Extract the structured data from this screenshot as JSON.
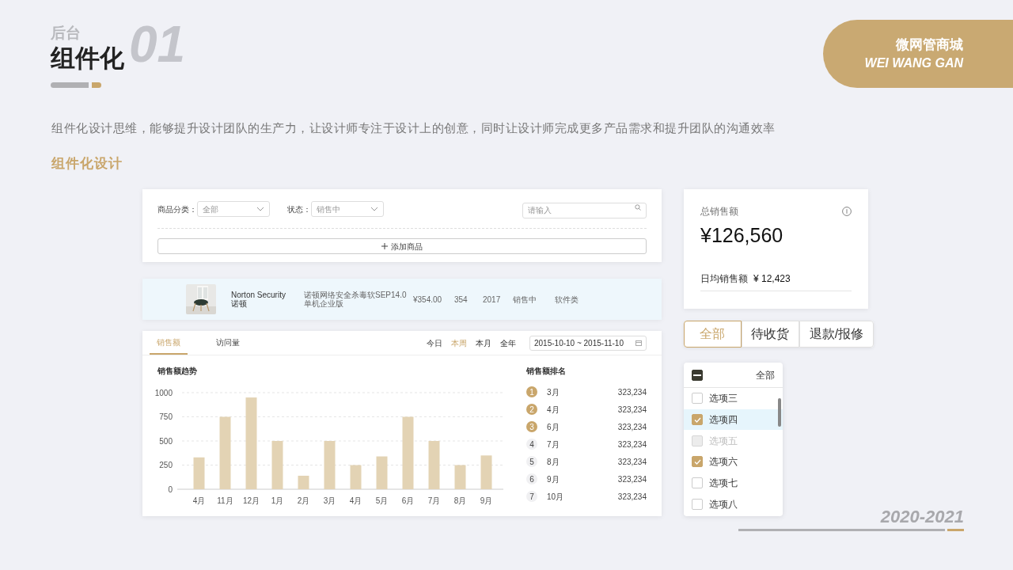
{
  "header": {
    "number": "01",
    "subtitle": "后台",
    "title": "组件化"
  },
  "brand": {
    "name": "微网管商城",
    "latin": "WEI WANG GAN"
  },
  "intro": "组件化设计思维，能够提升设计团队的生产力，让设计师专注于设计上的创意，同时让设计师完成更多产品需求和提升团队的沟通效率",
  "section_title": "组件化设计",
  "filter_card": {
    "fields": [
      {
        "label": "商品分类：",
        "placeholder": "全部"
      },
      {
        "label": "状态：",
        "placeholder": "销售中"
      }
    ],
    "search": {
      "placeholder": "请输入"
    },
    "add_button": "添加商品"
  },
  "product_row": {
    "name": "Norton Security",
    "name_cn": "诺顿",
    "description": "诺顿网络安全杀毒软SEP14.0单机企业版",
    "price": "¥354.00",
    "stock": "354",
    "year": "2017",
    "status": "销售中",
    "category": "软件类"
  },
  "sales_panel": {
    "tabs": [
      {
        "label": "销售额",
        "selected": true
      },
      {
        "label": "访问量",
        "selected": false
      }
    ],
    "periods": [
      {
        "label": "今日",
        "selected": false
      },
      {
        "label": "本周",
        "selected": true
      },
      {
        "label": "本月",
        "selected": false
      },
      {
        "label": "全年",
        "selected": false
      }
    ],
    "date_range": "2015-10-10 ~ 2015-11-10",
    "chart_title": "销售额趋势",
    "chart_data": {
      "type": "bar",
      "grid": true,
      "categories": [
        "4月",
        "11月",
        "12月",
        "1月",
        "2月",
        "3月",
        "4月",
        "5月",
        "6月",
        "7月",
        "8月",
        "9月"
      ],
      "series": [
        {
          "color": "#e3d3b4",
          "values": [
            330,
            750,
            950,
            500,
            140,
            500,
            250,
            340,
            750,
            500,
            250,
            350
          ]
        }
      ],
      "ylim": [
        0,
        1000
      ],
      "yticks": [
        0,
        250,
        500,
        750,
        1000
      ]
    },
    "ranking_title": "销售额排名",
    "ranking": [
      {
        "rank": "1",
        "month": "3月",
        "value": "323,234",
        "highlighted": true
      },
      {
        "rank": "2",
        "month": "4月",
        "value": "323,234",
        "highlighted": true
      },
      {
        "rank": "3",
        "month": "6月",
        "value": "323,234",
        "highlighted": true
      },
      {
        "rank": "4",
        "month": "7月",
        "value": "323,234",
        "highlighted": false
      },
      {
        "rank": "5",
        "month": "8月",
        "value": "323,234",
        "highlighted": false
      },
      {
        "rank": "6",
        "month": "9月",
        "value": "323,234",
        "highlighted": false
      },
      {
        "rank": "7",
        "month": "10月",
        "value": "323,234",
        "highlighted": false
      }
    ]
  },
  "stats": {
    "title": "总销售额",
    "amount": "¥126,560",
    "daily_label": "日均销售额",
    "daily_value": "¥ 12,423"
  },
  "segments": [
    {
      "label": "全部",
      "selected": true
    },
    {
      "label": "待收货",
      "selected": false
    },
    {
      "label": "退款/报修",
      "selected": false
    }
  ],
  "checklist": {
    "all_label": "全部",
    "all_partial": true,
    "items": [
      {
        "label": "选项三",
        "checked": false,
        "disabled": false,
        "selected": false
      },
      {
        "label": "选项四",
        "checked": true,
        "disabled": false,
        "selected": true
      },
      {
        "label": "选项五",
        "checked": false,
        "disabled": true,
        "selected": false
      },
      {
        "label": "选项六",
        "checked": true,
        "disabled": false,
        "selected": false
      },
      {
        "label": "选项七",
        "checked": false,
        "disabled": false,
        "selected": false
      },
      {
        "label": "选项八",
        "checked": false,
        "disabled": false,
        "selected": false
      }
    ]
  },
  "footer": {
    "years": "2020-2021"
  }
}
